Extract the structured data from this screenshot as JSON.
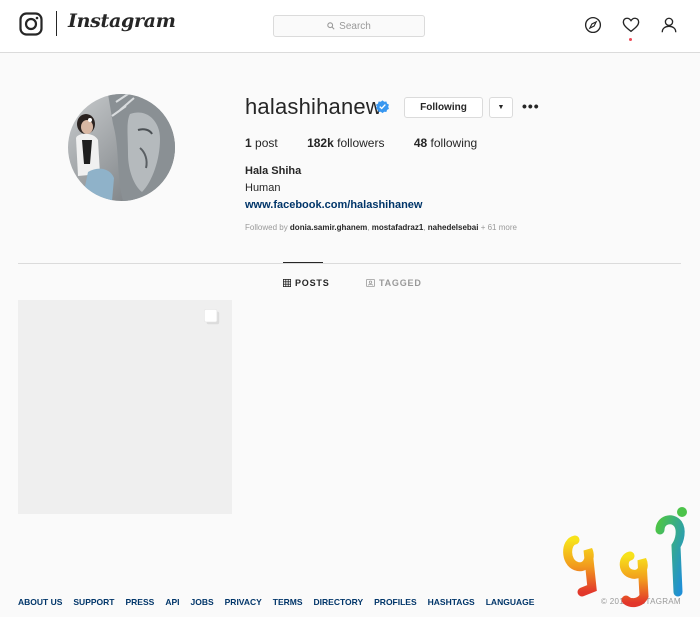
{
  "nav": {
    "brand": "Instagram",
    "search_placeholder": "Search",
    "icons": [
      "instagram-camera-icon",
      "search-icon",
      "explore-compass-icon",
      "activity-heart-icon",
      "profile-person-icon"
    ]
  },
  "profile": {
    "username": "halashihanew",
    "verified": true,
    "following_label": "Following",
    "more_label": "•••",
    "stats": {
      "posts_count": "1",
      "posts_label": "post",
      "followers_count": "182k",
      "followers_label": "followers",
      "following_count": "48",
      "following_label": "following"
    },
    "full_name": "Hala Shiha",
    "bio": "Human",
    "website": "www.facebook.com/halashihanew",
    "followed_by": {
      "prefix": "Followed by",
      "accounts": [
        "donia.samir.ghanem",
        "mostafadraz1",
        "nahedelsebai"
      ],
      "more": "+ 61 more"
    }
  },
  "tabs": [
    {
      "label": "POSTS",
      "active": true
    },
    {
      "label": "TAGGED",
      "active": false
    }
  ],
  "posts": [
    {
      "type": "carousel"
    }
  ],
  "footer": {
    "links": [
      "ABOUT US",
      "SUPPORT",
      "PRESS",
      "API",
      "JOBS",
      "PRIVACY",
      "TERMS",
      "DIRECTORY",
      "PROFILES",
      "HASHTAGS",
      "LANGUAGE"
    ],
    "copyright": "© 2018 INSTAGRAM"
  },
  "watermark_text": "نودا",
  "colors": {
    "background": "#fafafa",
    "border": "#dbdbdb",
    "text": "#262626",
    "muted": "#999999",
    "link": "#003569",
    "verified": "#3897f0",
    "notification": "#ed4956"
  }
}
